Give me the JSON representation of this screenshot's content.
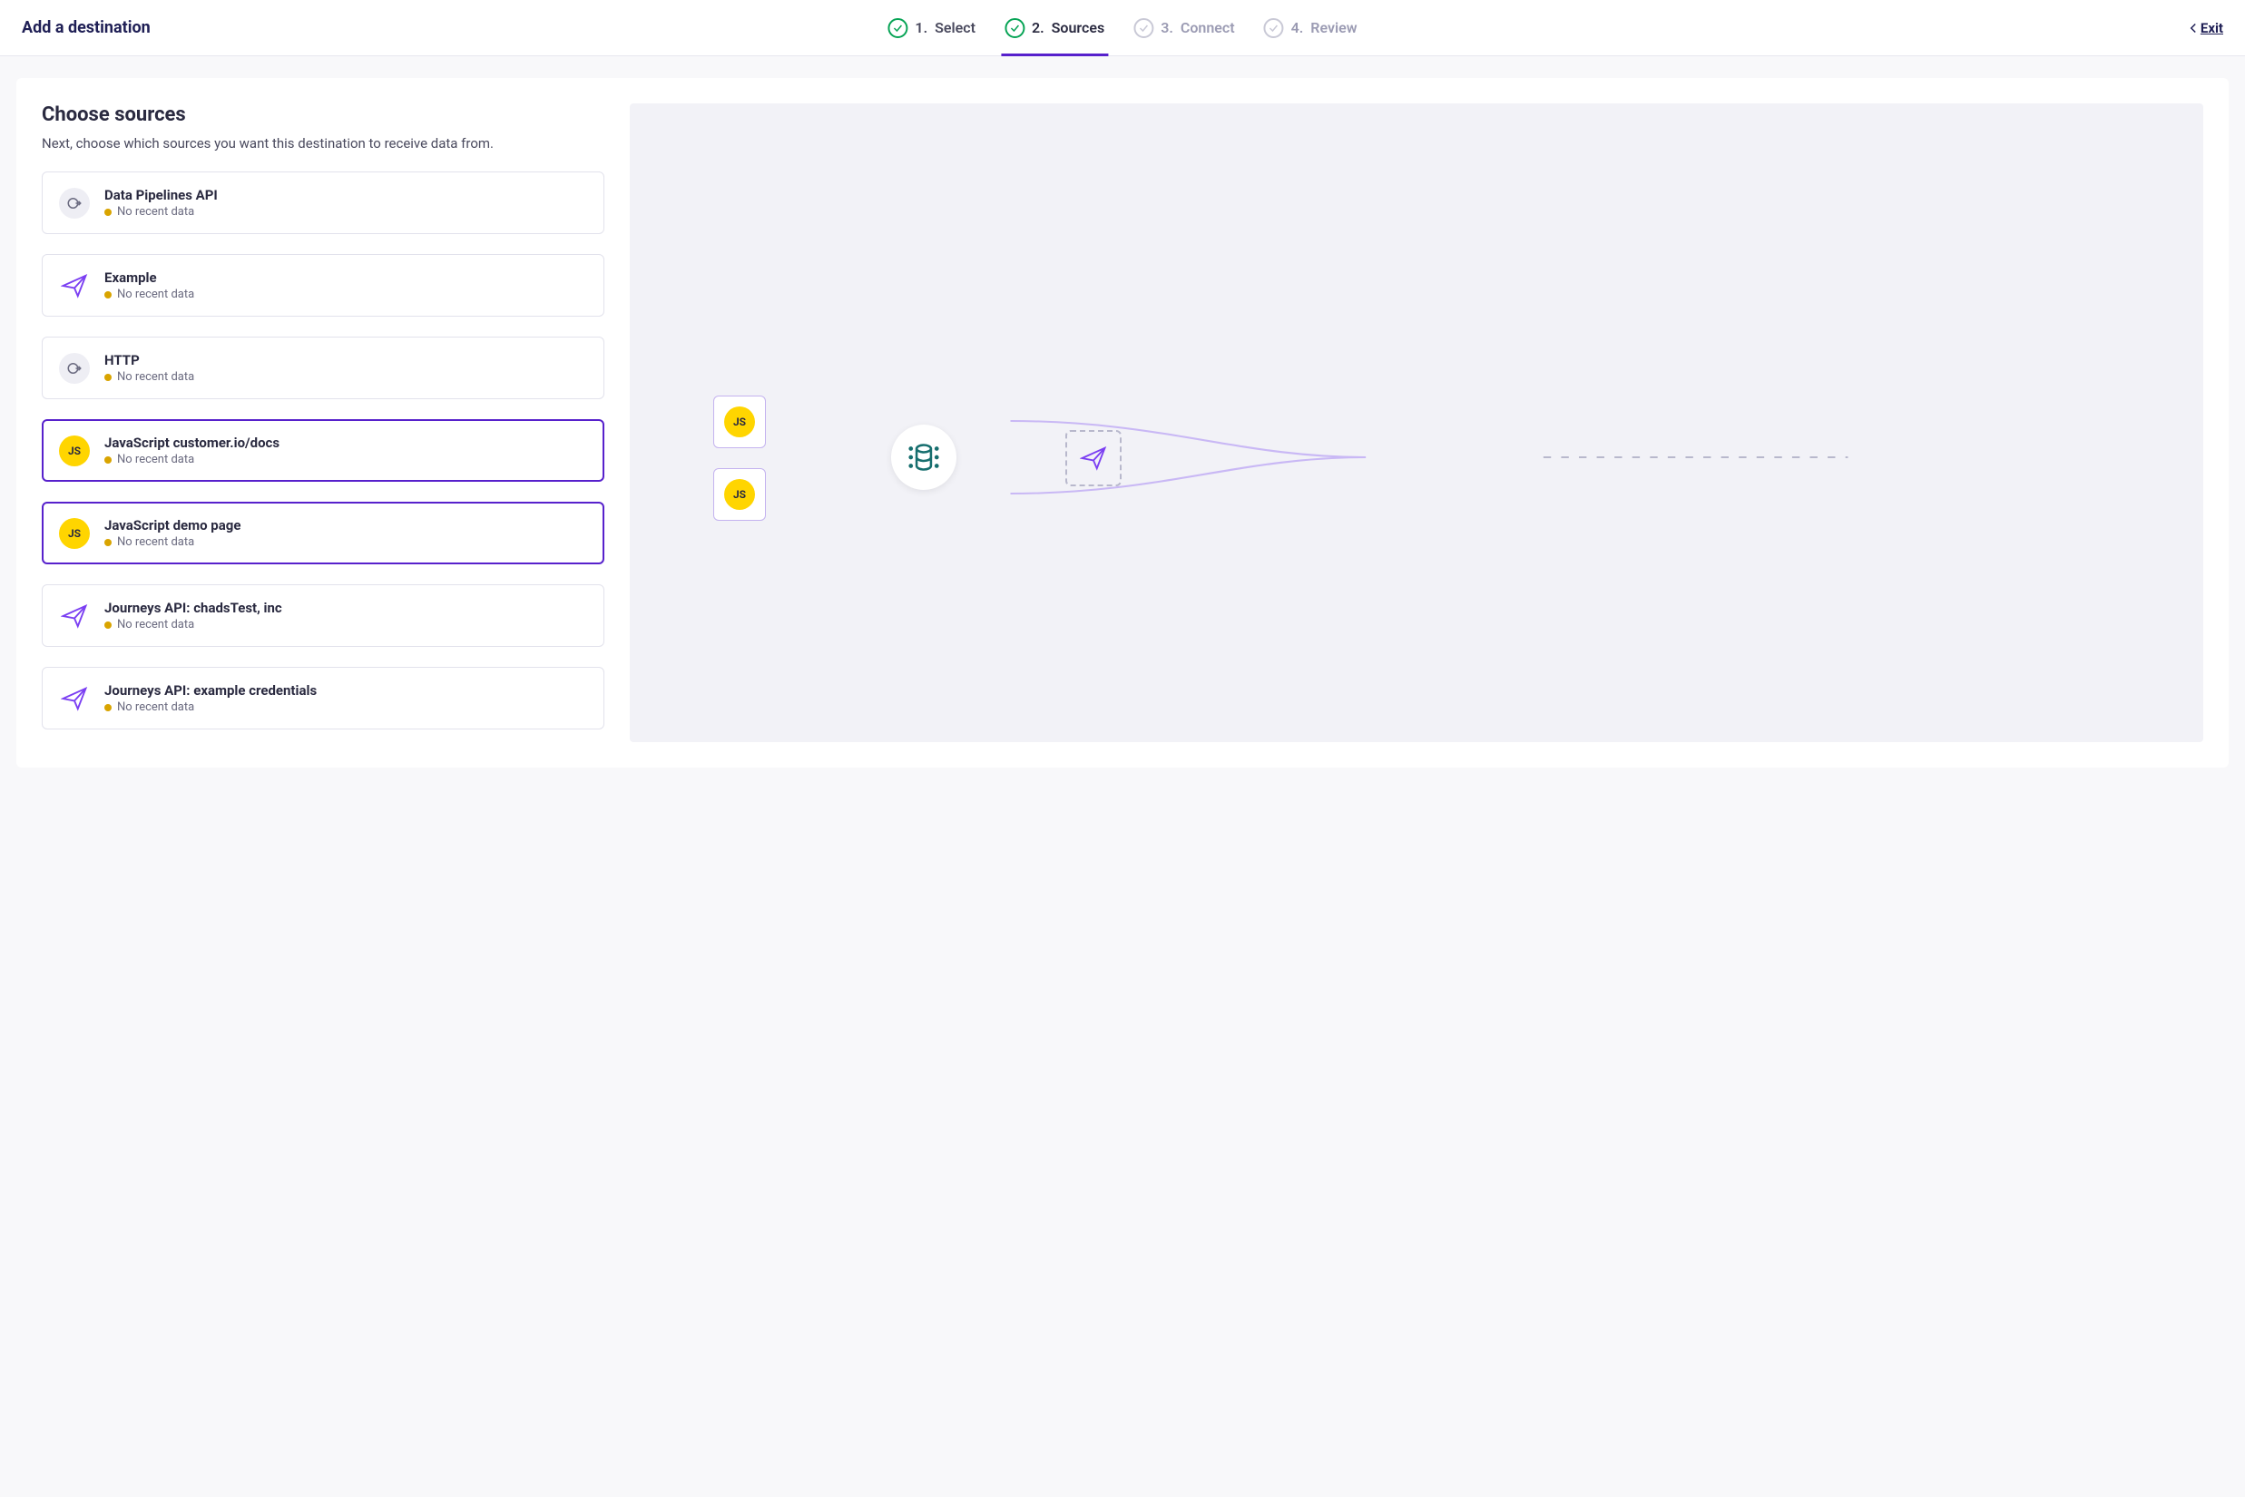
{
  "header": {
    "title": "Add a destination",
    "exit_label": "Exit"
  },
  "steps": [
    {
      "num": "1.",
      "label": "Select",
      "state": "completed"
    },
    {
      "num": "2.",
      "label": "Sources",
      "state": "active"
    },
    {
      "num": "3.",
      "label": "Connect",
      "state": "upcoming"
    },
    {
      "num": "4.",
      "label": "Review",
      "state": "upcoming"
    }
  ],
  "main": {
    "title": "Choose sources",
    "description": "Next, choose which sources you want this destination to receive data from."
  },
  "sources": [
    {
      "name": "Data Pipelines API",
      "status": "No recent data",
      "icon": "http",
      "selected": false
    },
    {
      "name": "Example",
      "status": "No recent data",
      "icon": "plane",
      "selected": false
    },
    {
      "name": "HTTP",
      "status": "No recent data",
      "icon": "http",
      "selected": false
    },
    {
      "name": "JavaScript customer.io/docs",
      "status": "No recent data",
      "icon": "js",
      "selected": true
    },
    {
      "name": "JavaScript demo page",
      "status": "No recent data",
      "icon": "js",
      "selected": true
    },
    {
      "name": "Journeys API: chadsTest, inc",
      "status": "No recent data",
      "icon": "plane",
      "selected": false
    },
    {
      "name": "Journeys API: example credentials",
      "status": "No recent data",
      "icon": "plane",
      "selected": false
    }
  ],
  "colors": {
    "accent": "#5721cc",
    "yellow": "#ffd500",
    "green": "#08a456",
    "text_dark": "#2a2a40"
  }
}
